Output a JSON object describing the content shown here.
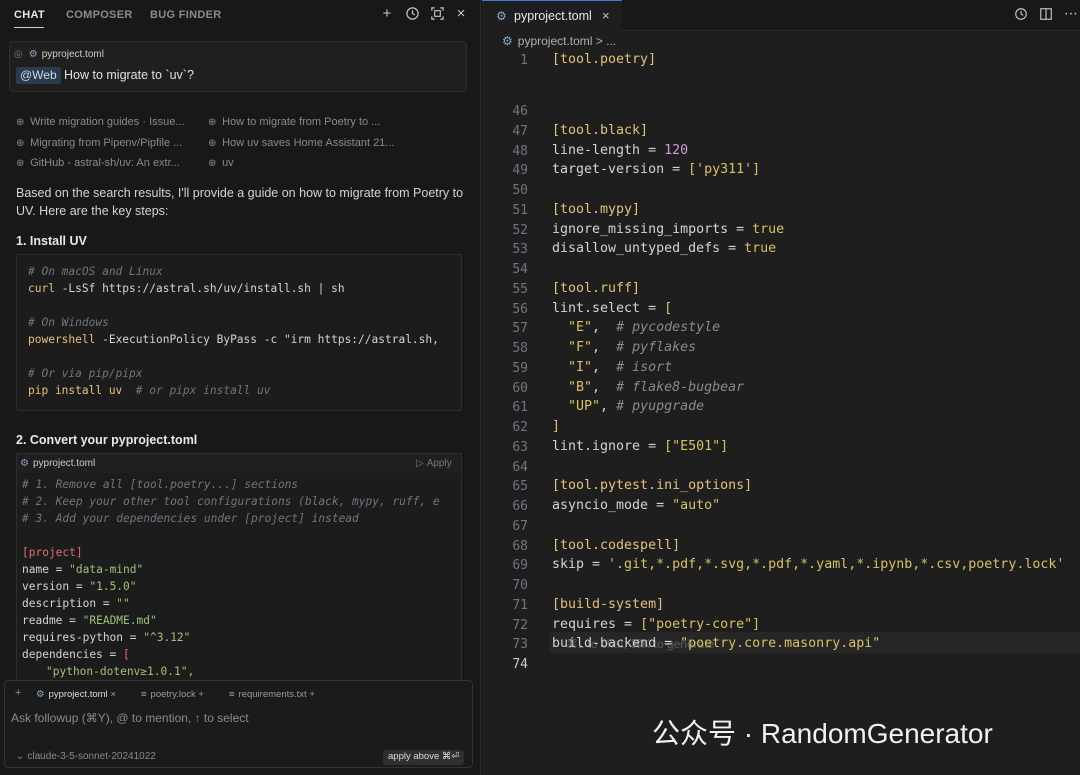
{
  "left_panel": {
    "tabs": [
      "CHAT",
      "COMPOSER",
      "BUG FINDER"
    ],
    "header_icons": [
      "plus-icon",
      "history-icon",
      "expand-icon",
      "close-icon"
    ],
    "query": {
      "file": "pyproject.toml",
      "mention": "@Web",
      "text": "How to migrate to `uv`?"
    },
    "sources": [
      "Write migration guides · Issue...",
      "How to migrate from Poetry to ...",
      "Migrating from Pipenv/Pipfile ...",
      "How uv saves Home Assistant 21...",
      "GitHub - astral-sh/uv: An extr...",
      "uv"
    ],
    "intro": "Based on the search results, I'll provide a guide on how to migrate from Poetry to UV. Here are the key steps:",
    "step1_heading": "1. Install UV",
    "step1_code": {
      "c1": "# On macOS and Linux",
      "l1_cmd": "curl",
      "l1_rest": " -LsSf https://astral.sh/uv/install.sh | sh",
      "c2": "# On Windows",
      "l2_cmd": "powershell",
      "l2_rest": " -ExecutionPolicy ByPass -c \"irm https://astral.sh,",
      "c3": "# Or via pip/pipx",
      "l3_cmd": "pip install uv",
      "l3_comment": "  # or pipx install uv"
    },
    "step2_heading": "2. Convert your pyproject.toml",
    "step2_code": {
      "file": "pyproject.toml",
      "apply": "Apply",
      "c1": "# 1. Remove all [tool.poetry...] sections",
      "c2": "# 2. Keep your other tool configurations (black, mypy, ruff, e",
      "c3": "# 3. Add your dependencies under [project] instead",
      "section": "[project]",
      "name_key": "name = ",
      "name_val": "\"data-mind\"",
      "version_key": "version = ",
      "version_val": "\"1.5.0\"",
      "desc_key": "description = ",
      "desc_val": "\"\"",
      "readme_key": "readme = ",
      "readme_val": "\"README.md\"",
      "req_key": "requires-python = ",
      "req_val": "\"^3.12\"",
      "deps_key": "dependencies = ",
      "deps_open": "[",
      "dep1": "\"python-dotenv≥1.0.1\","
    },
    "context_files": [
      "pyproject.toml",
      "poetry.lock",
      "requirements.txt"
    ],
    "input_placeholder": "Ask followup (⌘Y), @ to mention, ↑ to select",
    "model": "claude-3-5-sonnet-20241022",
    "apply_above": "apply above ⌘⏎"
  },
  "editor": {
    "tab_label": "pyproject.toml",
    "breadcrumb": "pyproject.toml > ...",
    "sticky": "[tool.poetry]",
    "sticky_line": "1",
    "lines": [
      {
        "n": "46",
        "t": ""
      },
      {
        "n": "47",
        "t": "[tool.black]"
      },
      {
        "n": "48",
        "t": "line-length = 120"
      },
      {
        "n": "49",
        "t": "target-version = ['py311']"
      },
      {
        "n": "50",
        "t": ""
      },
      {
        "n": "51",
        "t": "[tool.mypy]"
      },
      {
        "n": "52",
        "t": "ignore_missing_imports = true"
      },
      {
        "n": "53",
        "t": "disallow_untyped_defs = true"
      },
      {
        "n": "54",
        "t": ""
      },
      {
        "n": "55",
        "t": "[tool.ruff]"
      },
      {
        "n": "56",
        "t": "lint.select = ["
      },
      {
        "n": "57",
        "t": "  \"E\",  # pycodestyle"
      },
      {
        "n": "58",
        "t": "  \"F\",  # pyflakes"
      },
      {
        "n": "59",
        "t": "  \"I\",  # isort"
      },
      {
        "n": "60",
        "t": "  \"B\",  # flake8-bugbear"
      },
      {
        "n": "61",
        "t": "  \"UP\", # pyupgrade"
      },
      {
        "n": "62",
        "t": "]"
      },
      {
        "n": "63",
        "t": "lint.ignore = [\"E501\"]"
      },
      {
        "n": "64",
        "t": ""
      },
      {
        "n": "65",
        "t": "[tool.pytest.ini_options]"
      },
      {
        "n": "66",
        "t": "asyncio_mode = \"auto\""
      },
      {
        "n": "67",
        "t": ""
      },
      {
        "n": "68",
        "t": "[tool.codespell]"
      },
      {
        "n": "69",
        "t": "skip = '.git,*.pdf,*.svg,*.pdf,*.yaml,*.ipynb,*.csv,poetry.lock'"
      },
      {
        "n": "70",
        "t": ""
      },
      {
        "n": "71",
        "t": "[build-system]"
      },
      {
        "n": "72",
        "t": "requires = [\"poetry-core\"]"
      },
      {
        "n": "73",
        "t": "build-backend = \"poetry.core.masonry.api\""
      },
      {
        "n": "74",
        "t": ""
      }
    ],
    "ghost_hint": "⌘L to chat, ⌘K to generate"
  },
  "watermark": "公众号 · RandomGenerator"
}
